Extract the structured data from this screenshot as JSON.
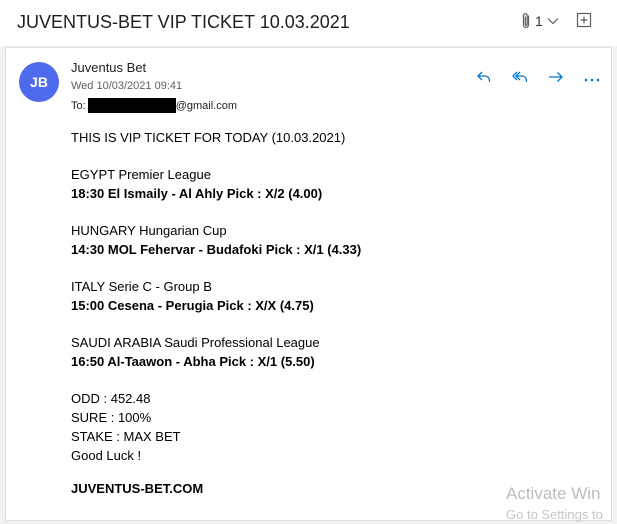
{
  "subject": "JUVENTUS-BET VIP TICKET 10.03.2021",
  "attachments": {
    "count": "1"
  },
  "message": {
    "avatar_initials": "JB",
    "sender": "Juventus Bet",
    "date": "Wed 10/03/2021 09:41",
    "to_label": "To:",
    "to_domain": "@gmail.com"
  },
  "body": {
    "intro": "THIS IS VIP TICKET FOR TODAY (10.03.2021)",
    "matches": [
      {
        "league": "EGYPT Premier League",
        "pick": "18:30  El Ismaily - Al Ahly  Pick : X/2 (4.00)"
      },
      {
        "league": "HUNGARY Hungarian Cup",
        "pick": "14:30  MOL Fehervar - Budafoki  Pick : X/1 (4.33)"
      },
      {
        "league": "ITALY Serie C - Group B",
        "pick": "15:00  Cesena - Perugia  Pick : X/X (4.75)"
      },
      {
        "league": "SAUDI ARABIA Saudi Professional League",
        "pick": "16:50  Al-Taawon - Abha  Pick : X/1 (5.50)"
      }
    ],
    "odd": "ODD : 452.48",
    "sure": "SURE : 100%",
    "stake": "STAKE : MAX BET",
    "closing": "Good Luck !",
    "signature": "JUVENTUS-BET.COM"
  },
  "watermark": {
    "line1": "Activate Win",
    "line2": "Go to Settings to"
  },
  "colors": {
    "avatar": "#4f6bed",
    "action_icon": "#0078d4"
  },
  "icons": [
    "paperclip-icon",
    "chevron-down-icon",
    "popout-icon",
    "reply-icon",
    "reply-all-icon",
    "forward-icon",
    "more-icon"
  ]
}
